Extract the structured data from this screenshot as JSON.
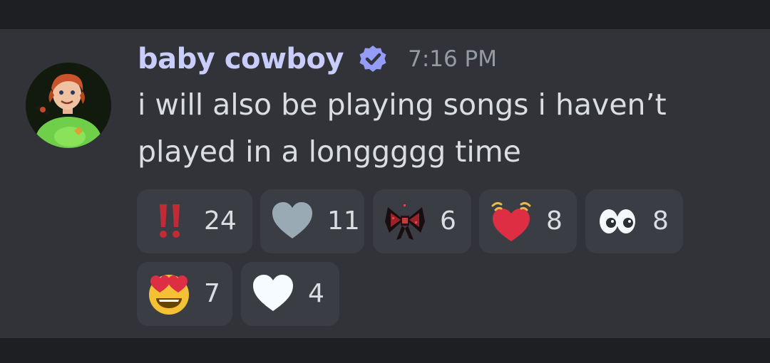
{
  "message": {
    "username": "baby cowboy",
    "timestamp": "7:16 PM",
    "text": "i will also be playing songs i haven’t played in a longgggg time",
    "username_color": "#c9cdfb",
    "badge_icon": "verified-check-icon",
    "badge_color": "#949cf7"
  },
  "reactions": [
    {
      "emoji": "double-exclamation-emoji",
      "count": "24"
    },
    {
      "emoji": "grey-heart-emoji",
      "count": "11"
    },
    {
      "emoji": "red-black-bow-custom-emoji",
      "count": "6"
    },
    {
      "emoji": "beating-red-heart-emoji",
      "count": "8"
    },
    {
      "emoji": "eyes-emoji",
      "count": "8"
    },
    {
      "emoji": "heart-eyes-face-emoji",
      "count": "7"
    },
    {
      "emoji": "white-heart-emoji",
      "count": "4"
    }
  ],
  "colors": {
    "background": "#1e1f22",
    "message_background": "#313338",
    "reaction_background": "#3b3d44",
    "text": "#dbdee1",
    "muted": "#949ba4"
  }
}
